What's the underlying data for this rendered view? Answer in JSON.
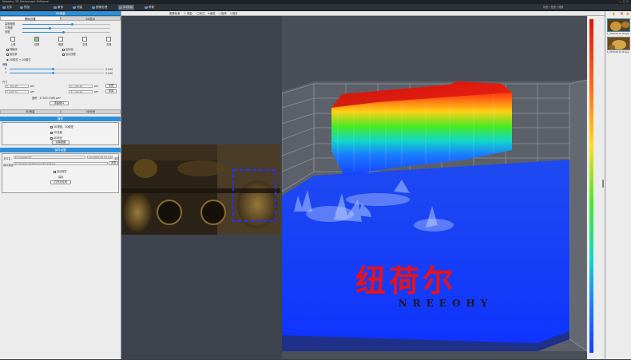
{
  "window": {
    "title": "Nreeohy 3D Microscope Software",
    "controls": "— ▢ ✕"
  },
  "toolbar": {
    "items": [
      {
        "label": "文件"
      },
      {
        "label": "预览"
      },
      {
        "label": "景深"
      },
      {
        "label": "测量"
      },
      {
        "label": "图像处理"
      },
      {
        "label": "3D测量"
      },
      {
        "label": "帮助"
      }
    ],
    "active_index": 5,
    "status_right": "状态 | 在线 | 设置"
  },
  "left": {
    "header_title": "3D测量",
    "tabs": [
      "基础设置",
      "3D显示"
    ],
    "sliders": [
      {
        "label": "高度缩放",
        "fill": 0.55
      },
      {
        "label": "平滑度",
        "fill": 0.3
      },
      {
        "label": "亮度",
        "fill": 0.45
      }
    ],
    "view_buttons": [
      "上视",
      "前视",
      "俯视",
      "左视",
      "右视",
      "后视"
    ],
    "checks": [
      "网格线",
      "坐标轴",
      "颜色条",
      "显示纹理"
    ],
    "radio_label": "◉ 3D模式   ○ 2D模式",
    "param_label": "网格",
    "param_sliders": [
      {
        "label": "X",
        "fill": 0.45,
        "value": "0.540"
      },
      {
        "label": "Y",
        "fill": 0.45,
        "value": "0.540"
      }
    ],
    "size_label": "尺寸",
    "size_rows": [
      {
        "a": "X: 320.05",
        "u1": "μm",
        "b": "高: 100.00",
        "u2": "μm",
        "btn": "应用"
      },
      {
        "a": "Y: 228.72",
        "u1": "μm",
        "b": "宽: 100.00",
        "u2": "μm",
        "btn": "重置"
      }
    ],
    "size_note": "面积：47583.1366 μm²",
    "apply_button": "重建窗口",
    "section_tabs": [
      "3D测量",
      "3D分析"
    ],
    "section2_title": "操作",
    "section2_checks": [
      "3D视图，3D模型",
      "3D亮度",
      "3D背景"
    ],
    "section2_button": "清除数据",
    "section3_title": "保存设置",
    "save_path_label": "文件名：",
    "save_path_value": "D:\\Images\\3D",
    "save_path_suffix": "jpg-2020-09-01.jpg",
    "save_path_btn": "浏览",
    "save_dir_label": "保存路径：",
    "save_dir_value": "D:\\Nreeohy\\Data\\Save\\3D\\Images",
    "save_dir_btn": "浏览",
    "save_check": "自动保存",
    "save_btn": "保存",
    "open_btn": "打开文件夹"
  },
  "midtoolbar": {
    "items": [
      "图像检索",
      "测距",
      "标注",
      "缩放",
      "旋转",
      "保存"
    ]
  },
  "thumbs": {
    "captions": [
      "1_2020-09-01 3D.jpg",
      "1_2020-09-01 3D.jpg"
    ]
  },
  "watermark": {
    "chinese": "纽荷尔",
    "latin": "NREEOHY"
  },
  "colors": {
    "accent": "#2d8fd6",
    "surface_high": "#e81e0f",
    "surface_low": "#1540ff",
    "selection_box": "#2233ff"
  }
}
